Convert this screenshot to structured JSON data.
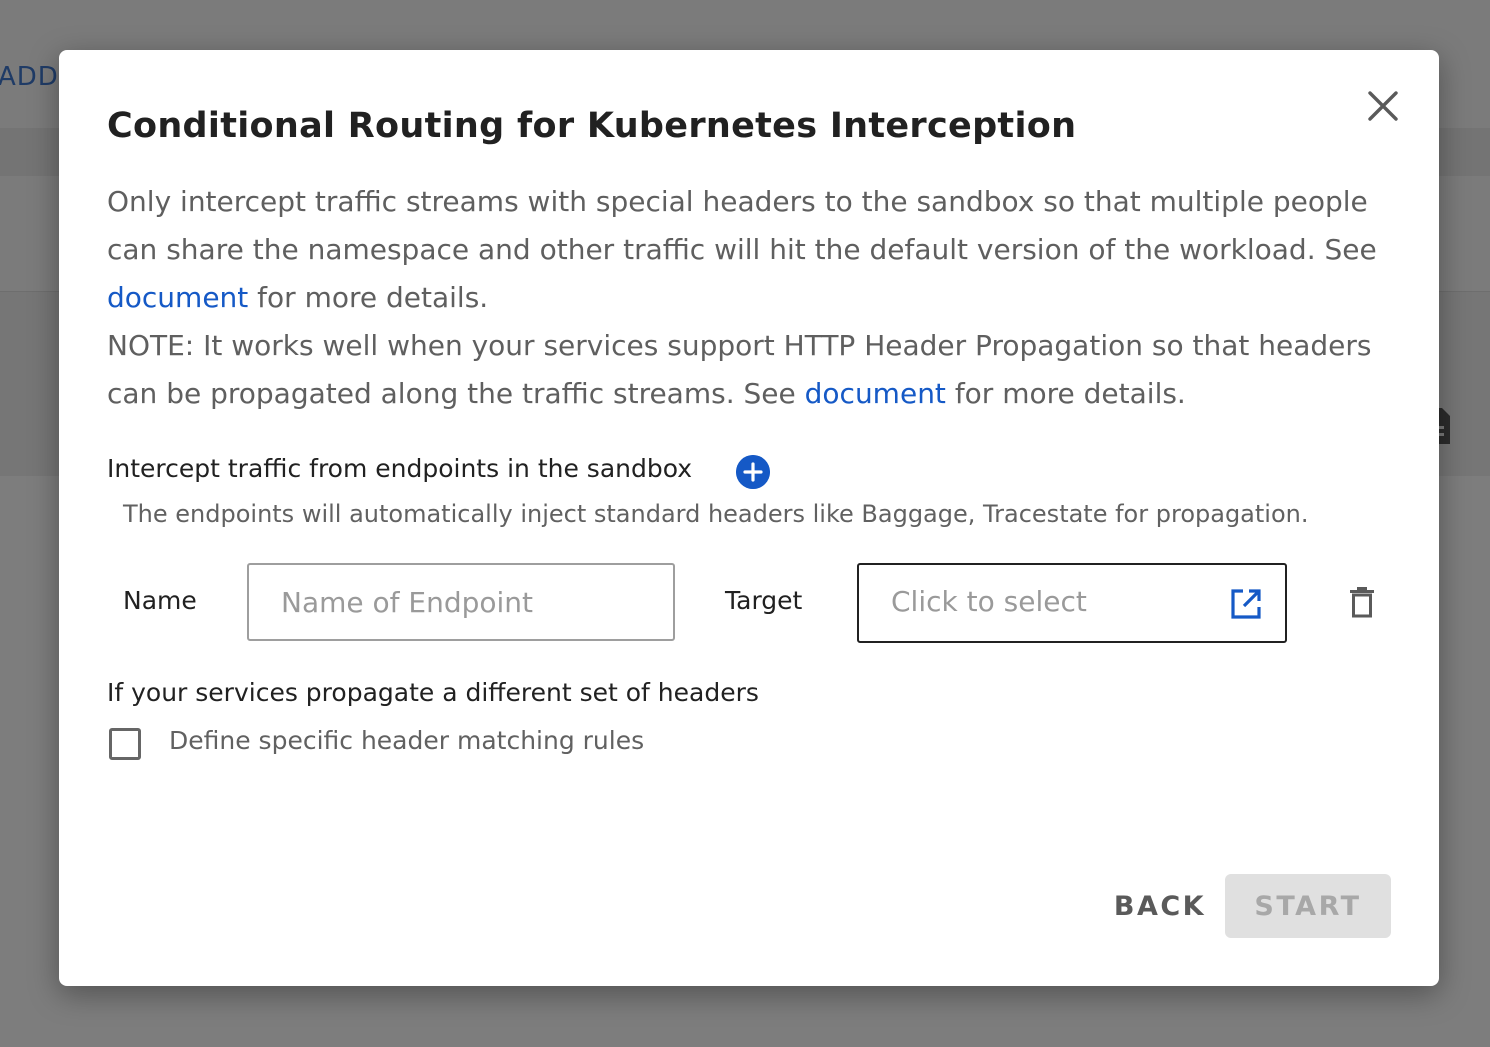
{
  "background": {
    "add_label": "ADD"
  },
  "dialog": {
    "title": "Conditional Routing for Kubernetes Interception",
    "description": {
      "line1_before_link": "Only intercept traffic streams with special headers to the sandbox so that multiple people can share the namespace and other traffic will hit the default version of the workload. See ",
      "line1_link": "document",
      "line1_after_link": " for more details.",
      "note_before_link": "NOTE: It works well when your services support HTTP Header Propagation so that headers can be propagated along the traffic streams. See ",
      "note_link": "document",
      "note_after_link": " for more details."
    },
    "endpoints": {
      "section_label": "Intercept traffic from endpoints in the sandbox",
      "hint": "The endpoints will automatically inject standard headers like Baggage, Tracestate for propagation.",
      "row": {
        "name_label": "Name",
        "name_value": "",
        "name_placeholder": "Name of Endpoint",
        "target_label": "Target",
        "target_placeholder": "Click to select"
      }
    },
    "headers": {
      "section_label": "If your services propagate a different set of headers",
      "checkbox_label": "Define specific header matching rules",
      "checkbox_checked": false
    },
    "actions": {
      "back_label": "BACK",
      "start_label": "START",
      "start_disabled": true
    }
  },
  "colors": {
    "accent": "#1559c6",
    "title_text": "#212121",
    "body_text": "#5f5f5f",
    "disabled_bg": "#e0e0e0",
    "disabled_text": "#a8a8a8"
  },
  "icons": {
    "close": "close-icon",
    "add": "plus-circle-icon",
    "open_selector": "open-in-new-icon",
    "delete": "trash-icon",
    "background_doc": "document-icon"
  }
}
